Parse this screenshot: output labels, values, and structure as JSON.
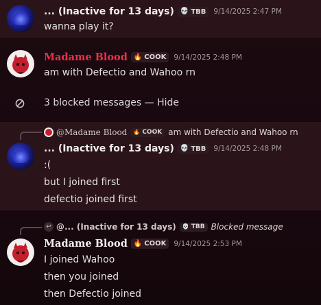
{
  "messages": {
    "m1": {
      "author": "... (Inactive for 13 days)",
      "tag_icon": "skull-icon",
      "tag": "TBB",
      "timestamp": "9/14/2025 2:47 PM",
      "lines": [
        "wanna play it?"
      ]
    },
    "m2": {
      "author": "Madame Blood",
      "author_color": "#e6334a",
      "tag_icon": "flame-icon",
      "tag": "COOK",
      "timestamp": "9/14/2025 2:48 PM",
      "lines": [
        "am with Defectio and Wahoo rn"
      ]
    },
    "blocked": {
      "text": "3 blocked messages — Hide"
    },
    "m3": {
      "reply": {
        "author": "@Madame Blood",
        "tag": "COOK",
        "text": "am with Defectio and Wahoo rn"
      },
      "author": "... (Inactive for 13 days)",
      "tag": "TBB",
      "timestamp": "9/14/2025 2:48 PM",
      "lines": [
        ":(",
        "but I joined first",
        "defectio joined first"
      ]
    },
    "m4": {
      "reply": {
        "author": "@... (Inactive for 13 days)",
        "tag": "TBB",
        "text": "Blocked message"
      },
      "author": "Madame Blood",
      "tag": "COOK",
      "timestamp": "9/14/2025 2:53 PM",
      "lines": [
        "I joined Wahoo",
        "then you joined",
        "then Defectio joined"
      ]
    }
  }
}
